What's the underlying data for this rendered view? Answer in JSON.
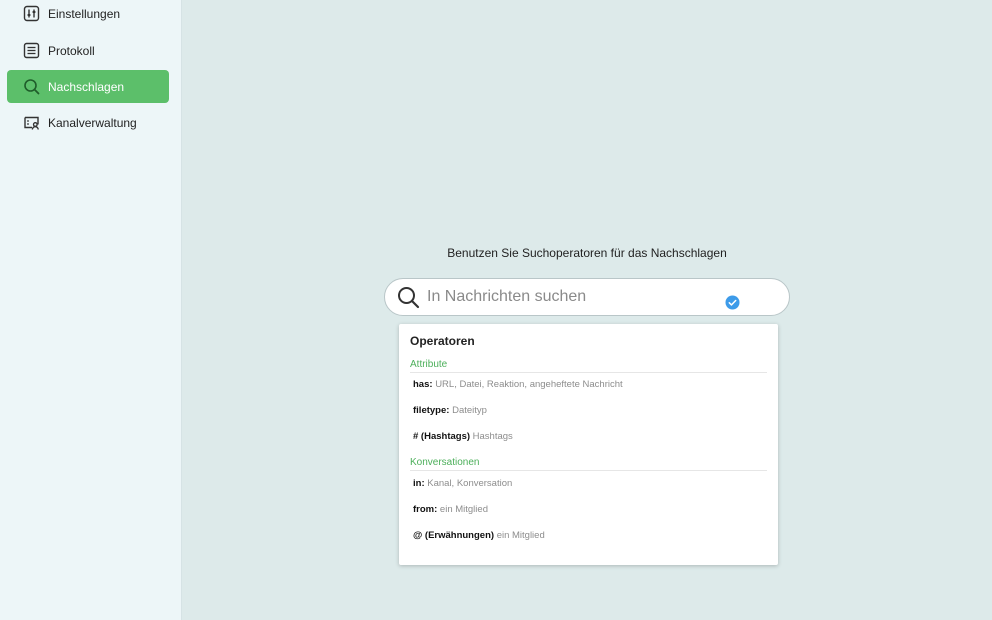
{
  "sidebar": {
    "items": [
      {
        "label": "Einstellungen",
        "icon": "settings-sliders-icon",
        "active": false
      },
      {
        "label": "Protokoll",
        "icon": "list-document-icon",
        "active": false
      },
      {
        "label": "Nachschlagen",
        "icon": "search-icon",
        "active": true
      },
      {
        "label": "Kanalverwaltung",
        "icon": "channel-user-icon",
        "active": false
      }
    ]
  },
  "main": {
    "hint": "Benutzen Sie Suchoperatoren für das Nachschlagen",
    "search": {
      "placeholder": "In Nachrichten suchen",
      "value": ""
    }
  },
  "dropdown": {
    "title": "Operatoren",
    "sections": [
      {
        "label": "Attribute",
        "items": [
          {
            "key": "has:",
            "desc": "URL, Datei, Reaktion, angeheftete Nachricht"
          },
          {
            "key": "filetype:",
            "desc": "Dateityp"
          },
          {
            "key": "# (Hashtags)",
            "desc": "Hashtags"
          }
        ]
      },
      {
        "label": "Konversationen",
        "items": [
          {
            "key": "in:",
            "desc": "Kanal, Konversation"
          },
          {
            "key": "from:",
            "desc": "ein Mitglied"
          },
          {
            "key": "@ (Erwähnungen)",
            "desc": "ein Mitglied"
          }
        ]
      }
    ]
  },
  "colors": {
    "accent": "#5cbf6a",
    "section_label": "#4caf5a",
    "check_badge": "#3d9be9",
    "background": "#ddeaea",
    "sidebar": "#edf6f8"
  }
}
